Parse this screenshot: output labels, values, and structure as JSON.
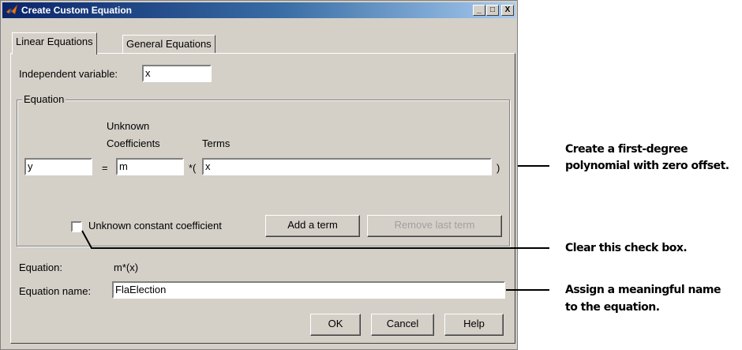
{
  "window": {
    "title": "Create Custom Equation",
    "icon": "matlab-logo-icon",
    "controls": {
      "minimize": "_",
      "maximize": "□",
      "close": "X"
    }
  },
  "tabs": [
    {
      "label": "Linear Equations",
      "active": true
    },
    {
      "label": "General Equations",
      "active": false
    }
  ],
  "form": {
    "independent_variable_label": "Independent variable:",
    "independent_variable_value": "x",
    "group_title": "Equation",
    "col_unknown": "Unknown",
    "col_coefficients": "Coefficients",
    "col_terms": "Terms",
    "lhs_value": "y",
    "equals": "=",
    "coefficient_value": "m",
    "times_open": "*(",
    "term_value": "x",
    "close_paren": ")",
    "constant_checkbox_label": "Unknown constant coefficient",
    "constant_checked": false,
    "add_term_button": "Add a term",
    "remove_term_button": "Remove last term",
    "equation_label": "Equation:",
    "equation_value": "m*(x)",
    "equation_name_label": "Equation name:",
    "equation_name_value": "FlaElection"
  },
  "buttons": {
    "ok": "OK",
    "cancel": "Cancel",
    "help": "Help"
  },
  "annotations": {
    "polynomial_line1": "Create a first-degree",
    "polynomial_line2": "polynomial with zero offset.",
    "checkbox_note": "Clear this check box.",
    "name_line1": "Assign a meaningful name",
    "name_line2": "to the equation."
  }
}
